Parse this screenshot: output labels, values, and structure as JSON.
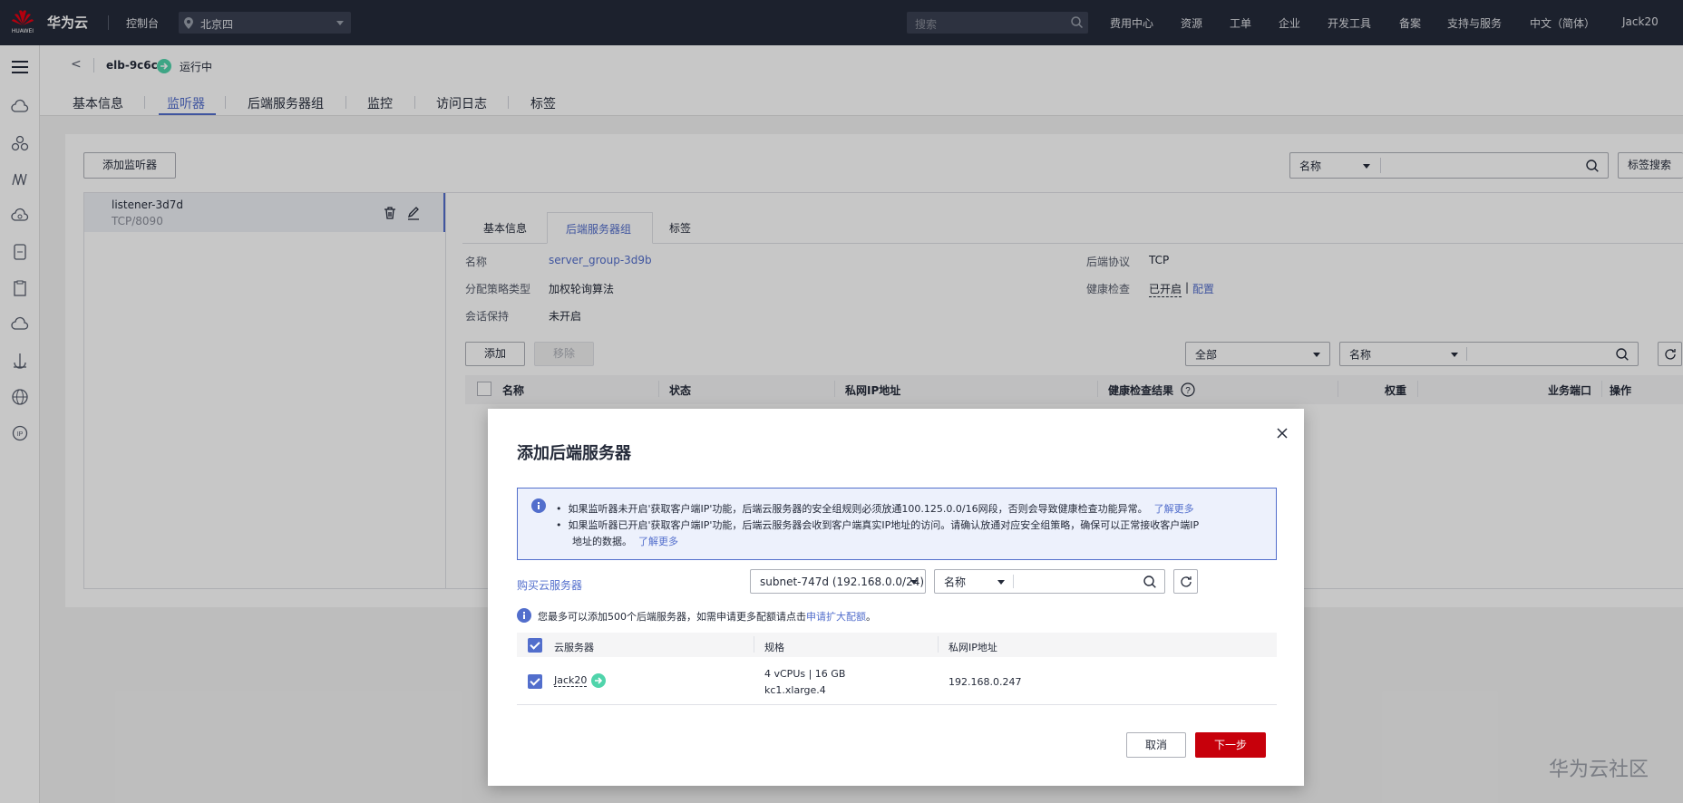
{
  "topbar": {
    "brand": "华为云",
    "logo_sub": "HUAWEI",
    "console": "控制台",
    "region": "北京四",
    "search_placeholder": "搜索",
    "nav": [
      "费用中心",
      "资源",
      "工单",
      "企业",
      "开发工具",
      "备案",
      "支持与服务",
      "中文（简体）",
      "Jack20"
    ]
  },
  "sidebar": {
    "icons": [
      "menu-icon",
      "cloud-server-icon",
      "cluster-icon",
      "network-icon",
      "cloud-disk-icon",
      "storage-icon",
      "doc-icon",
      "cloud-icon",
      "anchor-icon",
      "globe-icon",
      "ip-icon"
    ]
  },
  "header": {
    "back": "<",
    "elb_name": "elb-9c6c",
    "status": "运行中",
    "tabs": [
      "基本信息",
      "监听器",
      "后端服务器组",
      "监控",
      "访问日志",
      "标签"
    ],
    "active_tab": "监听器"
  },
  "listener_panel": {
    "add_listener": "添加监听器",
    "filter_select": "名称",
    "tag_search": "标签搜索",
    "listener": {
      "name": "listener-3d7d",
      "protocol": "TCP/8090"
    },
    "subtabs": [
      "基本信息",
      "后端服务器组",
      "标签"
    ],
    "active_subtab": "后端服务器组",
    "details": {
      "name_label": "名称",
      "name_value": "server_group-3d9b",
      "algo_label": "分配策略类型",
      "algo_value": "加权轮询算法",
      "session_label": "会话保持",
      "session_value": "未开启",
      "proto_label": "后端协议",
      "proto_value": "TCP",
      "health_label": "健康检查",
      "health_value": "已开启",
      "health_sep": "|",
      "health_config": "配置"
    },
    "add_btn": "添加",
    "remove_btn": "移除",
    "status_filter": "全部",
    "name_filter": "名称",
    "table_headers": [
      "名称",
      "状态",
      "私网IP地址",
      "健康检查结果",
      "权重",
      "业务端口",
      "操作"
    ]
  },
  "modal": {
    "title": "添加后端服务器",
    "notice": [
      "如果监听器未开启'获取客户端IP'功能，后端云服务器的安全组规则必须放通100.125.0.0/16网段，否则会导致健康检查功能异常。",
      "如果监听器已开启'获取客户端IP'功能，后端云服务器会收到客户端真实IP地址的访问。请确认放通对应安全组策略，确保可以正常接收客户端IP",
      "地址的数据。"
    ],
    "learn_more": "了解更多",
    "buy_link": "购买云服务器",
    "subnet": "subnet-747d (192.168.0.0/24)",
    "filter": "名称",
    "limit_text": "您最多可以添加500个后端服务器，如需申请更多配额请点击",
    "limit_link": "申请扩大配额",
    "limit_end": "。",
    "columns": [
      "云服务器",
      "规格",
      "私网IP地址"
    ],
    "rows": [
      {
        "name": "Jack20",
        "spec_line1": "4 vCPUs | 16 GB",
        "spec_line2": "kc1.xlarge.4",
        "ip": "192.168.0.247"
      }
    ],
    "cancel": "取消",
    "next": "下一步"
  },
  "watermark": "华为云社区",
  "colors": {
    "accent": "#526ecc",
    "primary_red": "#c7000b",
    "topbar": "#252b3a",
    "running": "#50d4ab"
  }
}
